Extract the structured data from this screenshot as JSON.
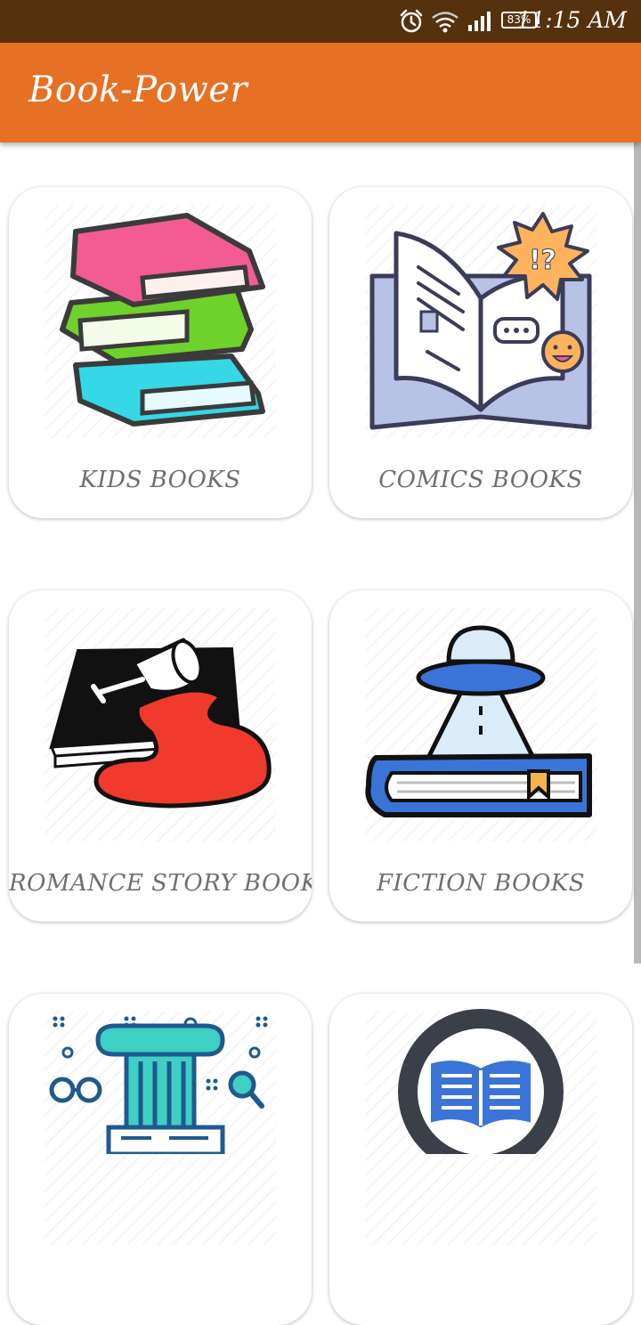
{
  "status_bar": {
    "time": "11:15 AM",
    "battery": "83%",
    "icons": [
      "alarm-icon",
      "wifi-icon",
      "signal-icon",
      "battery-icon"
    ]
  },
  "app_bar": {
    "title": "Book-Power",
    "color": "#e67024"
  },
  "categories": [
    {
      "label": "KIDS BOOKS",
      "icon": "stacked-books-icon"
    },
    {
      "label": "COMICS BOOKS",
      "icon": "comic-book-icon"
    },
    {
      "label": "ROMANCE STORY BOOKS",
      "icon": "romance-book-icon"
    },
    {
      "label": "FICTION BOOKS",
      "icon": "ufo-book-icon"
    },
    {
      "label": "",
      "icon": "library-icon"
    },
    {
      "label": "",
      "icon": "open-book-circle-icon"
    }
  ]
}
